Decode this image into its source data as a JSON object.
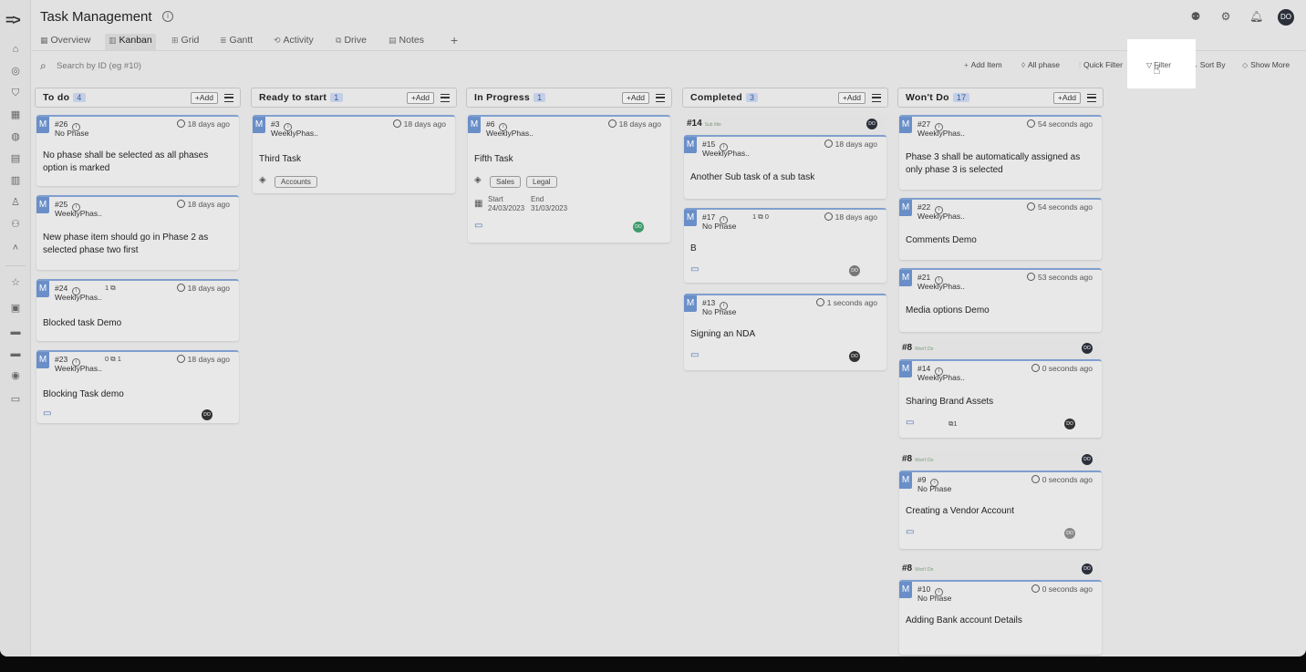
{
  "app": {
    "title": "Task Management",
    "avatar": "DO"
  },
  "tabs": [
    {
      "label": "Overview",
      "icon": "overview-icon"
    },
    {
      "label": "Kanban",
      "icon": "kanban-icon"
    },
    {
      "label": "Grid",
      "icon": "grid-icon"
    },
    {
      "label": "Gantt",
      "icon": "gantt-icon"
    },
    {
      "label": "Activity",
      "icon": "activity-icon"
    },
    {
      "label": "Drive",
      "icon": "drive-icon"
    },
    {
      "label": "Notes",
      "icon": "notes-icon"
    }
  ],
  "active_tab": "Kanban",
  "toolbar": {
    "search_placeholder": "Search by ID (eg #10)",
    "add_item": "Add Item",
    "all_phase": "All phase",
    "quick_filter": "Quick Filter",
    "filter": "Filter",
    "sort_by": "Sort By",
    "show_more": "Show More"
  },
  "columns": [
    {
      "name": "To do",
      "count": "4",
      "add": "+Add",
      "cards": [
        {
          "id": "#26",
          "phase": "No Phase",
          "time": "18 days ago",
          "title": "No phase shall be selected as all phases option is marked"
        },
        {
          "id": "#25",
          "phase": "WeeklyPhas..",
          "time": "18 days ago",
          "title": "New phase item should go in Phase 2 as selected phase two first"
        },
        {
          "id": "#24",
          "phase": "WeeklyPhas..",
          "time": "18 days ago",
          "deps": "1",
          "title": "Blocked task Demo"
        },
        {
          "id": "#23",
          "phase": "WeeklyPhas..",
          "time": "18 days ago",
          "deps": "0",
          "deps2": "1",
          "title": "Blocking Task demo",
          "avatar": "DO"
        }
      ]
    },
    {
      "name": "Ready to start",
      "count": "1",
      "add": "+Add",
      "cards": [
        {
          "id": "#3",
          "phase": "WeeklyPhas..",
          "time": "18 days ago",
          "title": "Third Task",
          "tags": [
            "Accounts"
          ]
        }
      ]
    },
    {
      "name": "In Progress",
      "count": "1",
      "add": "+Add",
      "cards": [
        {
          "id": "#6",
          "phase": "WeeklyPhas..",
          "time": "18 days ago",
          "title": "Fifth Task",
          "tags": [
            "Sales",
            "Legal"
          ],
          "start_label": "Start",
          "start": "24/03/2023",
          "end_label": "End",
          "end": "31/03/2023",
          "avatar": "DO"
        }
      ]
    },
    {
      "name": "Completed",
      "count": "3",
      "add": "+Add",
      "group": {
        "id": "#14",
        "sub": "Sub title",
        "avatar": "DO"
      },
      "cards": [
        {
          "id": "#15",
          "phase": "WeeklyPhas..",
          "time": "18 days ago",
          "title": "Another Sub task of a sub task"
        },
        {
          "id": "#17",
          "phase": "No Phase",
          "time": "18 days ago",
          "deps": "1",
          "deps2": "0",
          "title": "B",
          "avatar": "DO"
        },
        {
          "id": "#13",
          "phase": "No Phase",
          "time": "1 seconds ago",
          "title": "Signing an NDA",
          "avatar": "DO"
        }
      ]
    },
    {
      "name": "Won't Do",
      "count": "17",
      "add": "+Add",
      "cards": [
        {
          "id": "#27",
          "phase": "WeeklyPhas..",
          "time": "54 seconds ago",
          "title": "Phase 3 shall be automatically assigned as only phase 3 is selected"
        },
        {
          "id": "#22",
          "phase": "WeeklyPhas..",
          "time": "54 seconds ago",
          "title": "Comments Demo"
        },
        {
          "id": "#21",
          "phase": "WeeklyPhas..",
          "time": "53 seconds ago",
          "title": "Media options Demo"
        }
      ],
      "groups": [
        {
          "id": "#8",
          "sub": "Won't Do",
          "avatar": "DO",
          "card": {
            "id": "#14",
            "phase": "WeeklyPhas..",
            "time": "0 seconds ago",
            "title": "Sharing Brand Assets",
            "subtasks": "1",
            "avatar": "DO"
          }
        },
        {
          "id": "#8",
          "sub": "Won't Do",
          "avatar": "DO",
          "card": {
            "id": "#9",
            "phase": "No Phase",
            "time": "0 seconds ago",
            "title": "Creating a Vendor Account",
            "avatar": "DO"
          }
        },
        {
          "id": "#8",
          "sub": "Won't Do",
          "avatar": "DO",
          "card": {
            "id": "#10",
            "phase": "No Phase",
            "time": "0 seconds ago",
            "title": "Adding Bank account Details"
          }
        }
      ]
    }
  ],
  "colors": {
    "accent": "#6a8fc8",
    "card_border": "#7f9fcf",
    "highlight": "#ffffff"
  }
}
